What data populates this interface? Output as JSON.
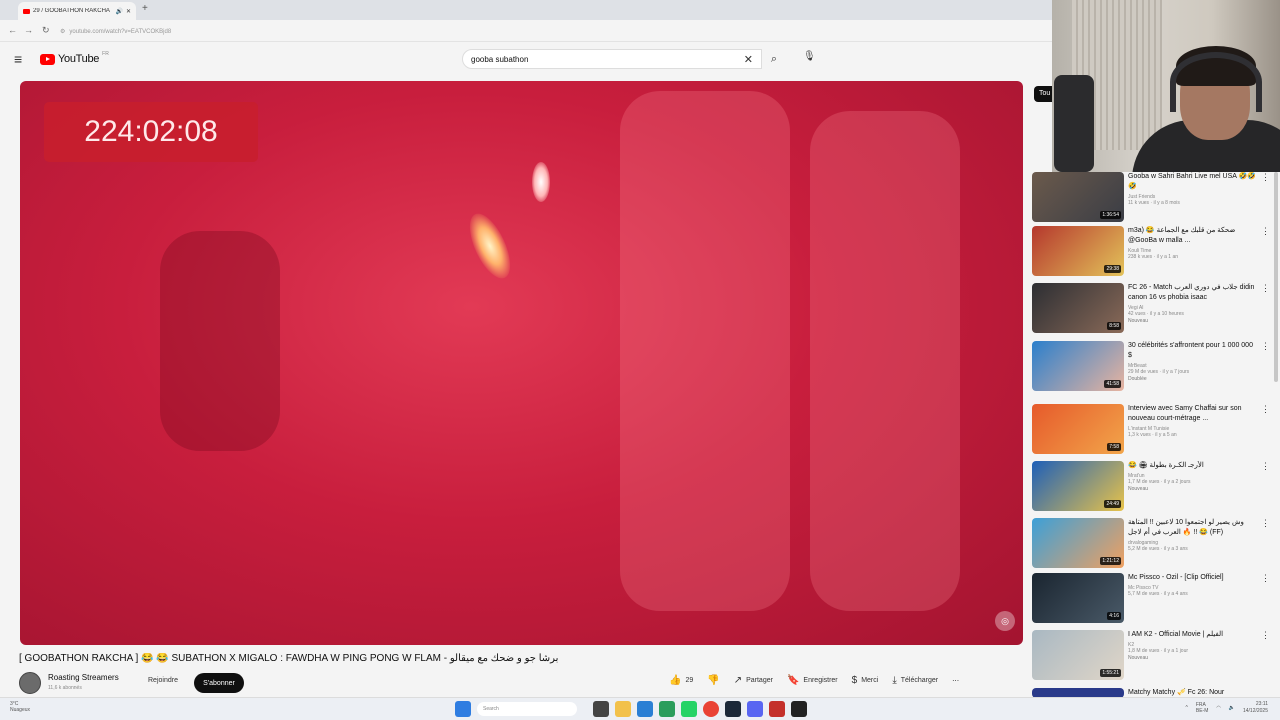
{
  "browser": {
    "tab_title": "29 / GOOBATHON RAKCHA",
    "tab_close": "✕",
    "new_tab": "+",
    "url": "youtube.com/watch?v=EATVCOKBjd8"
  },
  "youtube": {
    "logo_text": "YouTube",
    "logo_country": "FR",
    "search_value": "gooba subathon",
    "clear_icon": "✕",
    "search_icon": "⌕",
    "mic_icon": "🎙"
  },
  "player": {
    "timer": "224:02:08"
  },
  "video": {
    "title": "[ GOOBATHON RAKCHA ] 😂 😂 SUBATHON X MIGALO : FAWDHA W PING PONG W FLAM - برشا جو و ضحك مع ميقالو",
    "channel_name": "Roasting Streamers",
    "channel_subs": "11,6 k abonnés",
    "join_label": "Rejoindre",
    "subscribe_label": "S'abonner",
    "like_count": "29",
    "share_label": "Partager",
    "save_label": "Enregistrer",
    "thanks_label": "Merci",
    "download_label": "Télécharger",
    "more": "⋯"
  },
  "sidebar": {
    "chip": "Tou"
  },
  "recommendations": [
    {
      "title": "Gooba w Sahri Bahri Live mel USA 🤣🤣🤣",
      "channel": "Just Friends",
      "meta": "11 k vues · il y a 8 mois",
      "badge": "",
      "duration": "1:36:54",
      "c1": "#6b5a4c",
      "c2": "#3a3d45"
    },
    {
      "title": "m3a) 😂 ضحكة من قلبك مع الجماعة @GooBa w malla ...",
      "channel": "Kouli Time",
      "meta": "238 k vues · il y a 1 an",
      "badge": "",
      "duration": "29:38",
      "c1": "#b5372d",
      "c2": "#e3c35a"
    },
    {
      "title": "FC 26 - Match جلاب في دوري العرب didin canon 16 vs phobia isaac",
      "channel": "Vegi AI",
      "meta": "42 vues · il y a 10 heures",
      "badge": "Nouveau",
      "duration": "8:58",
      "c1": "#2c2e33",
      "c2": "#8a6a58"
    },
    {
      "title": "30 célébrités s'affrontent pour 1 000 000 $",
      "channel": "MrBeast",
      "meta": "29 M de vues · il y a 7 jours",
      "badge": "Doublée",
      "duration": "41:58",
      "c1": "#2b7fcc",
      "c2": "#e8b4a0"
    },
    {
      "title": "Interview avec Samy Chaffai sur son nouveau court-métrage ...",
      "channel": "L'instant M Tunisie",
      "meta": "1,3 k vues · il y a 5 an",
      "badge": "",
      "duration": "7:58",
      "c1": "#e65a2b",
      "c2": "#f2a54a"
    },
    {
      "title": "😂 🏟 الأرجـ الكـرة بطولة",
      "channel": "Mrat'un",
      "meta": "1,7 M de vues · il y a 2 jours",
      "badge": "Nouveau",
      "duration": "24:49",
      "c1": "#1e5fb8",
      "c2": "#e8c34a"
    },
    {
      "title": "وش يصير لو اجتمعوا 10 لاعبين !! المتاهة العرب في أم لاجل 🔥 !! 😂 (FF)",
      "channel": "drvalogaming",
      "meta": "5,2 M de vues · il y a 3 ans",
      "badge": "",
      "duration": "1:21:12",
      "c1": "#3ca0d8",
      "c2": "#f0a060"
    },
    {
      "title": "Mc Pissco - Ozil - [Clip Officiel]",
      "channel": "Mc Pissco TV",
      "meta": "5,7 M de vues · il y a 4 ans",
      "badge": "",
      "duration": "4:16",
      "c1": "#1a2530",
      "c2": "#4a5a68"
    },
    {
      "title": "I AM K2 - Official Movie | الفيلم",
      "channel": "K2",
      "meta": "1,8 M de vues · il y a 1 jour",
      "badge": "Nouveau",
      "duration": "1:55:21",
      "c1": "#a9b8c2",
      "c2": "#e0d6c8"
    }
  ],
  "partial_recommendation": "Matchy Matchy 🎺 Fc 26: Nour",
  "taskbar": {
    "weather": "3°C",
    "weather_sub": "Nuageux",
    "search_placeholder": "Search",
    "lang": "FRA\nBE-M",
    "time": "23:11",
    "date": "14/12/2025"
  },
  "colors": {
    "yt_red": "#ff0000",
    "subscribe_bg": "#0f0f0f",
    "player_red": "#c81e3d"
  }
}
